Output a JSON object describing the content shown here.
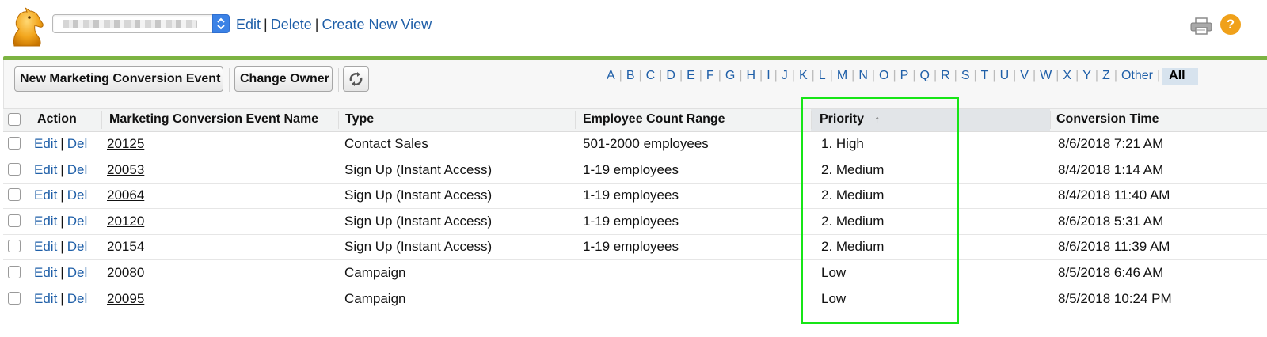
{
  "header": {
    "view_links": {
      "edit": "Edit",
      "delete": "Delete",
      "create": "Create New View"
    },
    "icons": {
      "logo": "app-logo-icon",
      "print": "print-icon",
      "help": "help-icon"
    },
    "help_glyph": "?"
  },
  "toolbar": {
    "new_button": "New Marketing Conversion Event",
    "owner_button": "Change Owner",
    "refresh_icon": "refresh-icon",
    "alphabet": [
      "A",
      "B",
      "C",
      "D",
      "E",
      "F",
      "G",
      "H",
      "I",
      "J",
      "K",
      "L",
      "M",
      "N",
      "O",
      "P",
      "Q",
      "R",
      "S",
      "T",
      "U",
      "V",
      "W",
      "X",
      "Y",
      "Z",
      "Other"
    ],
    "all_label": "All"
  },
  "table": {
    "columns": {
      "action": "Action",
      "name": "Marketing Conversion Event Name",
      "type": "Type",
      "employee_range": "Employee Count Range",
      "priority": "Priority",
      "sort_indicator": "↑",
      "conversion_time": "Conversion Time"
    },
    "action_labels": {
      "edit": "Edit",
      "del": "Del"
    },
    "rows": [
      {
        "name": "20125",
        "type": "Contact Sales",
        "employee_range": "501-2000 employees",
        "priority": "1. High",
        "time": "8/6/2018 7:21 AM"
      },
      {
        "name": "20053",
        "type": "Sign Up (Instant Access)",
        "employee_range": "1-19 employees",
        "priority": "2. Medium",
        "time": "8/4/2018 1:14 AM"
      },
      {
        "name": "20064",
        "type": "Sign Up (Instant Access)",
        "employee_range": "1-19 employees",
        "priority": "2. Medium",
        "time": "8/4/2018 11:40 AM"
      },
      {
        "name": "20120",
        "type": "Sign Up (Instant Access)",
        "employee_range": "1-19 employees",
        "priority": "2. Medium",
        "time": "8/6/2018 5:31 AM"
      },
      {
        "name": "20154",
        "type": "Sign Up (Instant Access)",
        "employee_range": "1-19 employees",
        "priority": "2. Medium",
        "time": "8/6/2018 11:39 AM"
      },
      {
        "name": "20080",
        "type": "Campaign",
        "employee_range": "",
        "priority": "Low",
        "time": "8/5/2018 6:46 AM"
      },
      {
        "name": "20095",
        "type": "Campaign",
        "employee_range": "",
        "priority": "Low",
        "time": "8/5/2018 10:24 PM"
      }
    ]
  },
  "colors": {
    "accent_green": "#7cb342",
    "link_blue": "#1f5fa8",
    "highlight": "#16e516",
    "help_orange": "#f0a11a"
  }
}
